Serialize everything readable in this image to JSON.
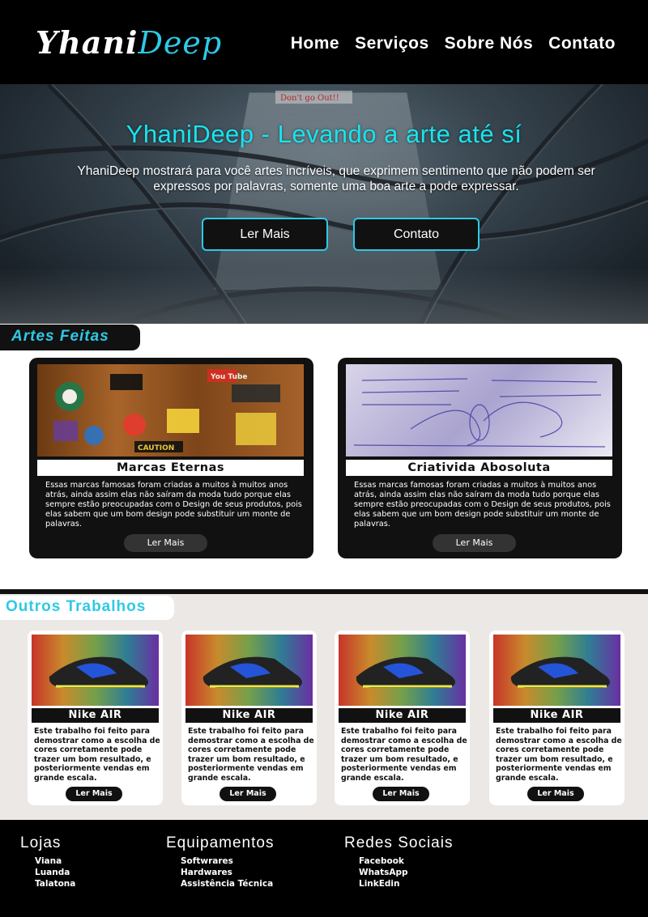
{
  "header": {
    "logo_part1": "Yhani",
    "logo_part2": "Deep",
    "nav": [
      "Home",
      "Serviços",
      "Sobre Nós",
      "Contato"
    ]
  },
  "hero": {
    "title": "YhaniDeep - Levando a arte até sí",
    "text": "YhaniDeep mostrará para você artes incríveis, que exprimem sentimento que não podem ser expressos por palavras, somente uma boa arte a pode expressar.",
    "btn_more": "Ler Mais",
    "btn_contact": "Contato",
    "sign_text": "Don't go Out!!"
  },
  "artes": {
    "label": "Artes Feitas",
    "cards": [
      {
        "title": "Marcas Eternas",
        "desc": "Essas marcas famosas foram criadas a muitos à muitos anos atrás, ainda assim elas não saíram da moda tudo porque  elas sempre estão preocupadas com o Design de seus produtos, pois elas sabem que um bom design pode substituir um monte de palavras.",
        "button": "Ler Mais",
        "img_labels": [
          "You Tube",
          "CAUTION"
        ]
      },
      {
        "title": "Criativida Abosoluta",
        "desc": "Essas marcas famosas foram criadas a muitos à muitos anos atrás, ainda assim elas não saíram da moda tudo porque  elas sempre estão preocupadas com o Design de seus produtos, pois elas sabem que um bom design pode substituir um monte de palavras.",
        "button": "Ler Mais"
      }
    ]
  },
  "outros": {
    "label": "Outros Trabalhos",
    "cards": [
      {
        "title": "Nike AIR",
        "desc": "Este trabalho foi feito para demostrar como a escolha de cores corretamente pode trazer um bom resultado, e posteriormente vendas em grande escala.",
        "button": "Ler Mais"
      },
      {
        "title": "Nike AIR",
        "desc": "Este trabalho foi feito para demostrar como a escolha de cores corretamente pode trazer um bom resultado, e posteriormente vendas em grande escala.",
        "button": "Ler Mais"
      },
      {
        "title": "Nike AIR",
        "desc": "Este trabalho foi feito para demostrar como a escolha de cores corretamente pode trazer um bom resultado, e posteriormente vendas em grande escala.",
        "button": "Ler Mais"
      },
      {
        "title": "Nike AIR",
        "desc": "Este trabalho foi feito para demostrar como a escolha de cores corretamente pode trazer um bom resultado, e posteriormente vendas em grande escala.",
        "button": "Ler Mais"
      }
    ]
  },
  "footer": {
    "columns": [
      {
        "title": "Lojas",
        "items": [
          "Viana",
          "Luanda",
          "Talatona"
        ]
      },
      {
        "title": "Equipamentos",
        "items": [
          "Softwrares",
          "Hardwares",
          "Assistência Técnica"
        ]
      },
      {
        "title": "Redes Sociais",
        "items": [
          "Facebook",
          "WhatsApp",
          "LinkEdin"
        ]
      }
    ]
  },
  "colors": {
    "accent": "#2ec9e6",
    "dark": "#111111",
    "light_bg": "#ece8e6"
  }
}
